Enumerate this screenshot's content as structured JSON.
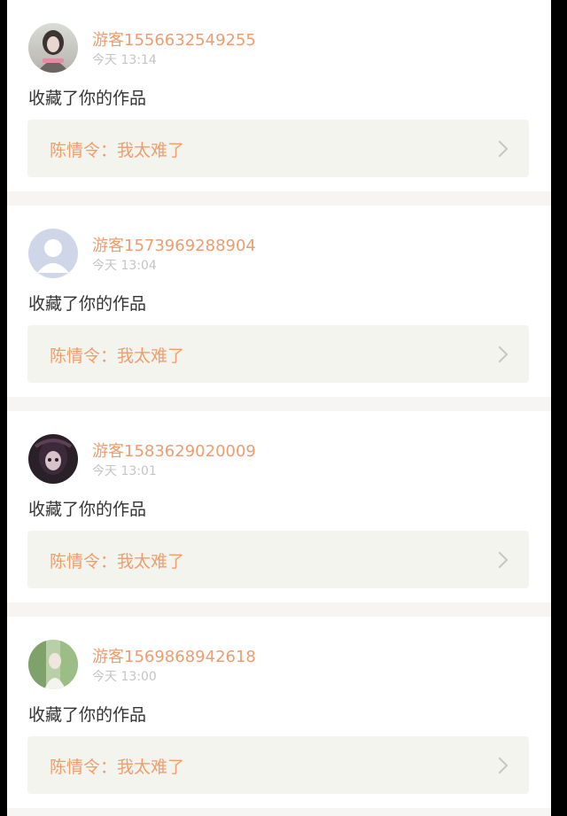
{
  "notifications": [
    {
      "username": "游客1556632549255",
      "time": "今天 13:14",
      "action": "收藏了你的作品",
      "work_title": "陈情令：我太难了",
      "avatar": "girl-photo-avatar"
    },
    {
      "username": "游客1573969288904",
      "time": "今天 13:04",
      "action": "收藏了你的作品",
      "work_title": "陈情令：我太难了",
      "avatar": "default-user-avatar"
    },
    {
      "username": "游客1583629020009",
      "time": "今天 13:01",
      "action": "收藏了你的作品",
      "work_title": "陈情令：我太难了",
      "avatar": "doll-photo-avatar"
    },
    {
      "username": "游客1569868942618",
      "time": "今天 13:00",
      "action": "收藏了你的作品",
      "work_title": "陈情令：我太难了",
      "avatar": "nature-photo-avatar"
    }
  ],
  "colors": {
    "accent": "#ee9d6e",
    "time": "#c4c4c4",
    "text": "#333333",
    "link_bg": "#f4f4ee",
    "separator": "#f7f4f4"
  }
}
